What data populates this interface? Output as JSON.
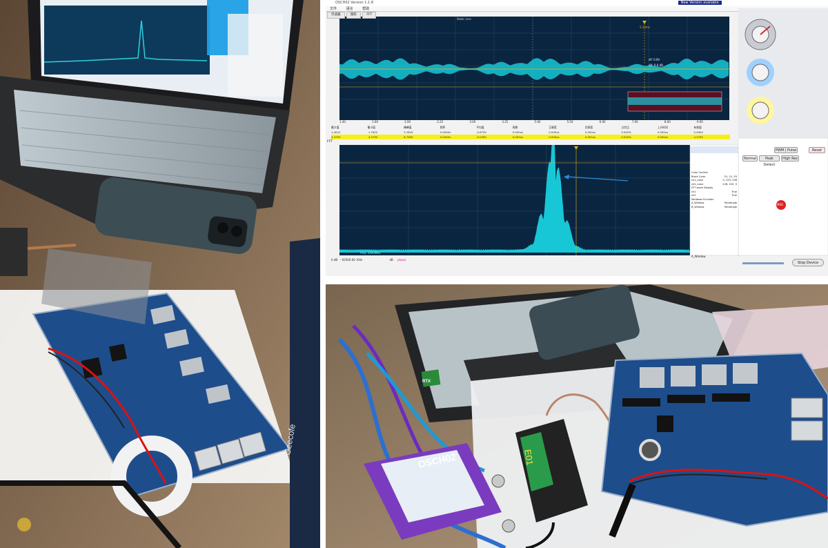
{
  "app": {
    "title": "OSCH02 Version 1.1.8",
    "update_notice": "New Version available",
    "menu": [
      "文件",
      "语言",
      "帮助"
    ],
    "tabs": [
      "示波器",
      "图形",
      "FFT"
    ],
    "top_right_menu": [
      "设置",
      "分析",
      "测量",
      "显示",
      "工具",
      "保存",
      "运行",
      "帮助"
    ],
    "scope_title": "Static Live",
    "cursor_label": "5.23ms",
    "cursor_values": [
      "dY: 0.0V",
      "dX: 0.0 dB"
    ],
    "time_ticks": [
      "1.40",
      "1.60",
      "2.00",
      "2.25",
      "3.00",
      "3.25",
      "5.00",
      "5.50",
      "6.00",
      "7.00",
      "8.00",
      "9.00"
    ]
  },
  "measure_table": {
    "headers": [
      "最大值",
      "最小值",
      "峰峰值",
      "频率",
      "平均值",
      "周期",
      "正脉宽",
      "负脉宽",
      "占空比",
      "上升时间",
      "有效值"
    ],
    "rows": [
      [
        "1.402V",
        "-1.782V",
        "3.184V",
        "0.000Hz",
        "-0.875V",
        "0.000us",
        "0.000us",
        "0.000us",
        "0.000%",
        "0.000us",
        "0.000V"
      ],
      [
        "4.379V",
        "-4.379V",
        "8.758V",
        "0.000Hz",
        "-0.030V",
        "0.000us",
        "0.000us",
        "0.000us",
        "0.000%",
        "0.000us",
        "4.379V"
      ]
    ]
  },
  "fft": {
    "tab_label": "FFT",
    "panel_rows": [
      "Color Control",
      "Black Color",
      "ch1_color",
      "ch2_color",
      "FFT wave Display",
      "ch1",
      "ch2",
      "Windows Function",
      "A_Window",
      "B_Window"
    ],
    "panel_values": [
      "",
      "",
      "51, 21, 55",
      "0, 229, 238",
      "226, 225, 0",
      "",
      "True",
      "True",
      "",
      "Rectangle",
      "Rectangle"
    ],
    "bottom_label": "A_Window",
    "status_left": "0 dB",
    "status_mid": "- 92500.00",
    "status_unit": "KHz",
    "marker_labels": [
      "dB",
      "phase"
    ],
    "readout": "freq: 1000MHz"
  },
  "controls": {
    "mode_buttons": [
      "Normal",
      "Peak Detect",
      "High Res"
    ],
    "pwm_button": "PWM | Pulse",
    "reset_button": "Reset",
    "stop_button": "Stop Device",
    "logo_text": "MDS"
  },
  "hardware_labels": {
    "scope_box": "OSCH02",
    "module": "E01",
    "board_label_left": "Geecofe",
    "gpu_sticker": "RTX"
  },
  "colors": {
    "wave_cyan": "#18c7d6",
    "scope_bg": "#0a2540",
    "cursor_yellow": "#e7b31a",
    "pcb_blue": "#1e4d8c",
    "highlight_row": "#f6ef1e"
  }
}
